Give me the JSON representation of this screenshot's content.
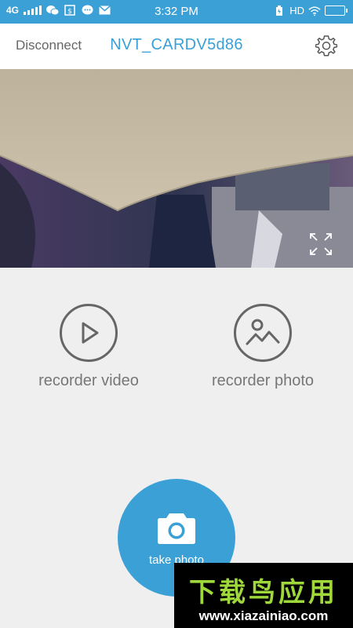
{
  "status_bar": {
    "network": "4G",
    "time": "3:32 PM",
    "hd": "HD",
    "icons": [
      "signal-icon",
      "wechat-icon",
      "notification-icon",
      "message-icon",
      "mail-icon",
      "battery-saver-icon",
      "wifi-icon",
      "battery-icon"
    ]
  },
  "header": {
    "disconnect_label": "Disconnect",
    "device_name": "NVT_CARDV5d86",
    "settings_icon": "gear-icon"
  },
  "preview": {
    "fullscreen_icon": "fullscreen-icon"
  },
  "modes": {
    "video_label": "recorder video",
    "photo_label": "recorder photo"
  },
  "capture": {
    "take_photo_label": "take photo"
  },
  "watermark": {
    "title": "下载鸟应用",
    "url": "www.xiazainiao.com"
  },
  "colors": {
    "accent": "#3aa0d6",
    "background": "#efefef",
    "text_muted": "#777777"
  }
}
